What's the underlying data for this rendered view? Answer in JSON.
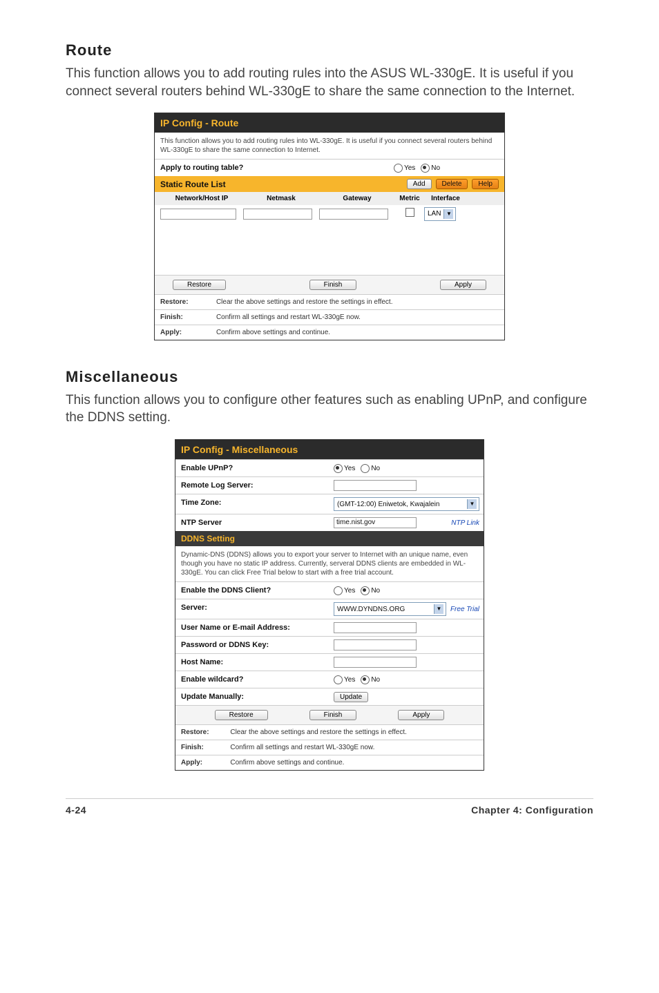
{
  "section1": {
    "title": "Route",
    "body": "This function allows you to add routing rules into the ASUS WL-330gE. It is useful if you connect several routers behind WL-330gE to share the same connection to the Internet."
  },
  "route": {
    "banner": "IP Config - Route",
    "intro": "This function allows you to add routing rules into WL-330gE. It is useful if you connect several routers behind WL-330gE to share the same connection to Internet.",
    "apply_label": "Apply to routing table?",
    "yes": "Yes",
    "no": "No",
    "static_list": "Static Route List",
    "btn_add": "Add",
    "btn_delete": "Delete",
    "btn_help": "Help",
    "cols": {
      "nhost": "Network/Host IP",
      "mask": "Netmask",
      "gw": "Gateway",
      "metric": "Metric",
      "iface": "Interface"
    },
    "iface_value": "LAN",
    "btn_restore": "Restore",
    "btn_finish": "Finish",
    "btn_apply": "Apply"
  },
  "section2": {
    "title": "Miscellaneous",
    "body": "This function allows you to configure other features such as enabling UPnP, and configure the DDNS setting."
  },
  "misc": {
    "banner": "IP Config - Miscellaneous",
    "enable_upnp": "Enable UPnP?",
    "remote_log": "Remote Log Server:",
    "timezone_label": "Time Zone:",
    "timezone_value": "(GMT-12:00) Eniwetok, Kwajalein",
    "ntp_label": "NTP Server",
    "ntp_value": "time.nist.gov",
    "ntp_link": "NTP Link",
    "ddns_title": "DDNS Setting",
    "ddns_intro": "Dynamic-DNS (DDNS) allows you to export your server to Internet with an unique name, even though you have no static IP address. Currently, serveral DDNS clients are embedded in WL-330gE. You can click Free Trial below to start with a free trial account.",
    "enable_ddns": "Enable the DDNS Client?",
    "server_label": "Server:",
    "server_value": "WWW.DYNDNS.ORG",
    "free_trial": "Free Trial",
    "user_label": "User Name or E-mail Address:",
    "password_label": "Password or DDNS Key:",
    "host_label": "Host Name:",
    "wildcard_label": "Enable wildcard?",
    "update_label": "Update Manually:",
    "update_btn": "Update",
    "btn_restore": "Restore",
    "btn_finish": "Finish",
    "btn_apply": "Apply",
    "yes": "Yes",
    "no": "No"
  },
  "helper": {
    "restore_label": "Restore:",
    "restore_text": "Clear the above settings and restore the settings in effect.",
    "finish_label": "Finish:",
    "finish_text": "Confirm all settings and restart WL-330gE now.",
    "apply_label": "Apply:",
    "apply_text": "Confirm above settings and continue."
  },
  "footer": {
    "page": "4-24",
    "chapter": "Chapter 4: Configuration"
  }
}
